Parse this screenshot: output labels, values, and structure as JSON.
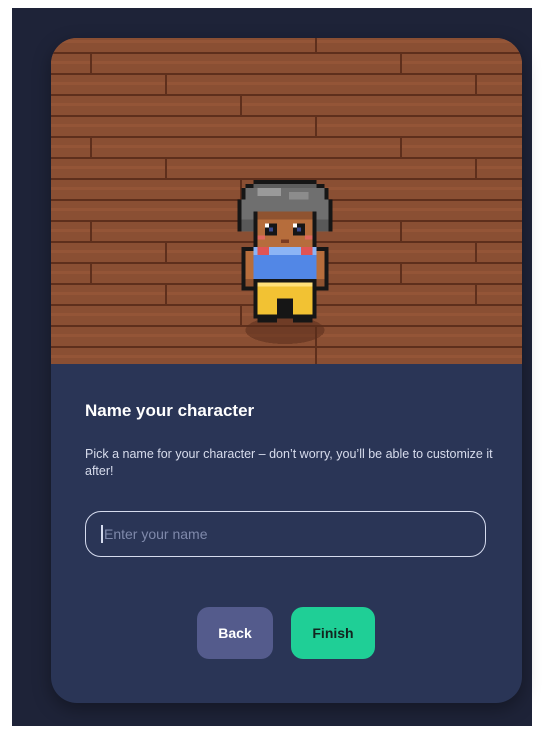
{
  "dialog": {
    "title": "Name your character",
    "description": "Pick a name for your character – don’t worry, you’ll be able to customize it after!",
    "name_input": {
      "value": "",
      "placeholder": "Enter your name"
    },
    "back_label": "Back",
    "finish_label": "Finish"
  },
  "colors": {
    "backdrop": "#1e2338",
    "card": "#2a3556",
    "floor": "#8a4f33",
    "floor_seam": "#5e2f1c",
    "back_button": "#545b8c",
    "finish_button": "#1fcf96"
  },
  "icons": {
    "character_sprite": "pixel-avatar-icon"
  }
}
